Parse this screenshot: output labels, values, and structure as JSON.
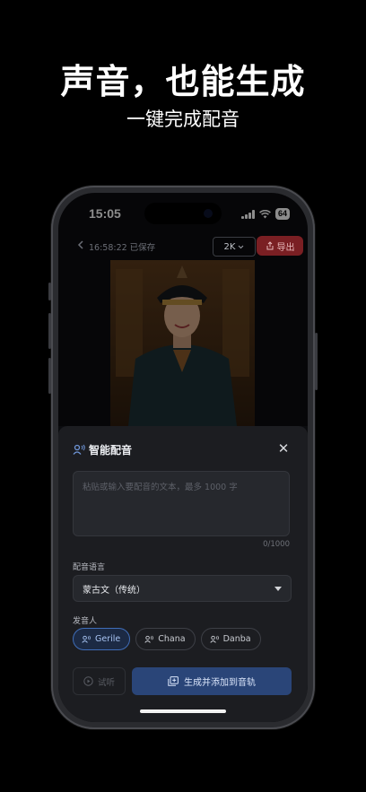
{
  "hero": {
    "title": "声音，也能生成",
    "subtitle": "一键完成配音"
  },
  "status": {
    "time": "15:05",
    "battery": "64"
  },
  "nav": {
    "saved_text": "16:58:22 已保存",
    "resolution": "2K",
    "export_label": "导出"
  },
  "sheet": {
    "title": "智能配音",
    "placeholder": "粘贴或输入要配音的文本，最多 1000 字",
    "counter": "0/1000",
    "language_label": "配音语言",
    "language_value": "蒙古文（传统）",
    "speaker_label": "发音人",
    "speakers": [
      {
        "name": "Gerile",
        "selected": true
      },
      {
        "name": "Chana",
        "selected": false
      },
      {
        "name": "Danba",
        "selected": false
      }
    ],
    "preview_label": "试听",
    "generate_label": "生成并添加到音轨"
  },
  "colors": {
    "accent_blue": "#2a4578",
    "export_red": "#7a1f23",
    "chip_selected": "#3f6db8"
  }
}
